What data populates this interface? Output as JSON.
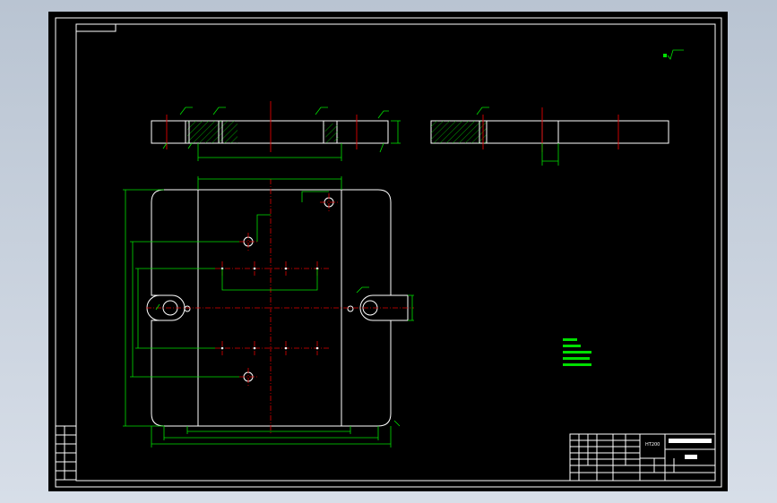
{
  "colors": {
    "background": "#000000",
    "outline": "#ffffff",
    "dimension": "#00e000",
    "centerline": "#e00000"
  },
  "title_block": {
    "drawing_code": "HT200"
  }
}
